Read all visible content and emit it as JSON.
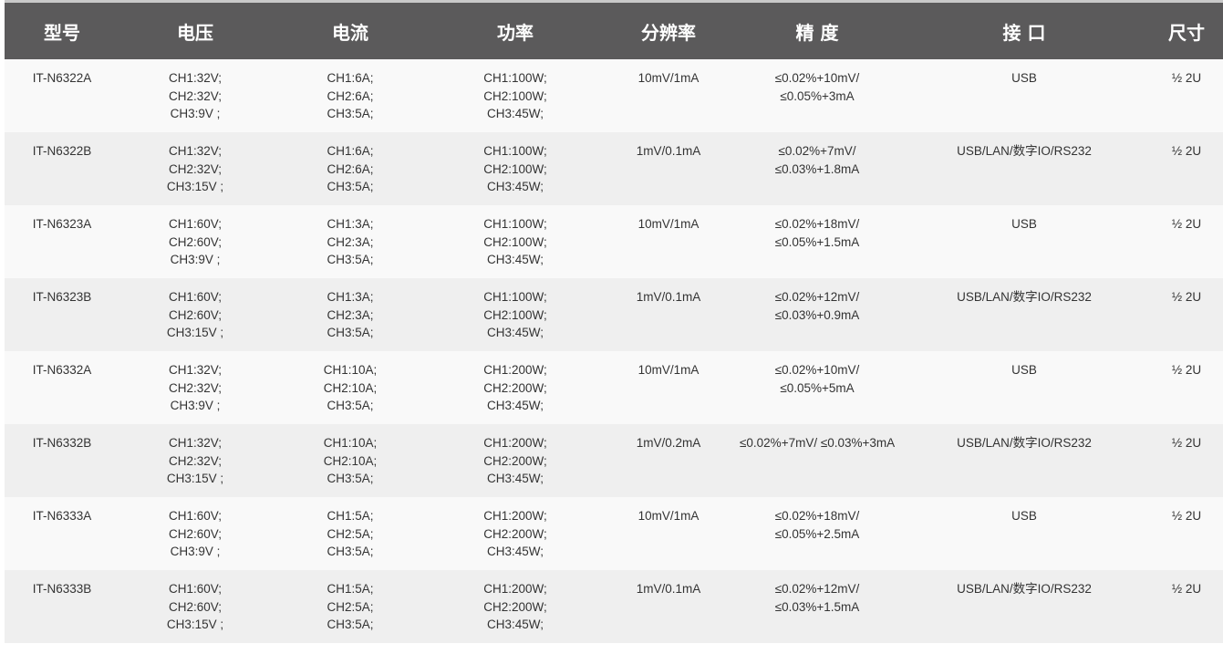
{
  "headers": [
    "型号",
    "电压",
    "电流",
    "功率",
    "分辨率",
    "精 度",
    "接 口",
    "尺寸"
  ],
  "rows": [
    {
      "model": "IT-N6322A",
      "voltage": [
        "CH1:32V;",
        "CH2:32V;",
        "CH3:9V ;"
      ],
      "current": [
        "CH1:6A;",
        "CH2:6A;",
        "CH3:5A;"
      ],
      "power": [
        "CH1:100W;",
        "CH2:100W;",
        "CH3:45W;"
      ],
      "resolution": "10mV/1mA",
      "accuracy": [
        "≤0.02%+10mV/",
        "≤0.05%+3mA"
      ],
      "interface": "USB",
      "size": "½ 2U"
    },
    {
      "model": "IT-N6322B",
      "voltage": [
        "CH1:32V;",
        "CH2:32V;",
        "CH3:15V ;"
      ],
      "current": [
        "CH1:6A;",
        "CH2:6A;",
        "CH3:5A;"
      ],
      "power": [
        "CH1:100W;",
        "CH2:100W;",
        "CH3:45W;"
      ],
      "resolution": "1mV/0.1mA",
      "accuracy": [
        "≤0.02%+7mV/",
        "≤0.03%+1.8mA"
      ],
      "interface": "USB/LAN/数字IO/RS232",
      "size": "½ 2U"
    },
    {
      "model": "IT-N6323A",
      "voltage": [
        "CH1:60V;",
        "CH2:60V;",
        "CH3:9V ;"
      ],
      "current": [
        "CH1:3A;",
        "CH2:3A;",
        "CH3:5A;"
      ],
      "power": [
        "CH1:100W;",
        "CH2:100W;",
        "CH3:45W;"
      ],
      "resolution": "10mV/1mA",
      "accuracy": [
        "≤0.02%+18mV/",
        "≤0.05%+1.5mA"
      ],
      "interface": "USB",
      "size": "½ 2U"
    },
    {
      "model": "IT-N6323B",
      "voltage": [
        "CH1:60V;",
        "CH2:60V;",
        "CH3:15V ;"
      ],
      "current": [
        "CH1:3A;",
        "CH2:3A;",
        "CH3:5A;"
      ],
      "power": [
        "CH1:100W;",
        "CH2:100W;",
        "CH3:45W;"
      ],
      "resolution": "1mV/0.1mA",
      "accuracy": [
        "≤0.02%+12mV/",
        "≤0.03%+0.9mA"
      ],
      "interface": "USB/LAN/数字IO/RS232",
      "size": "½ 2U"
    },
    {
      "model": "IT-N6332A",
      "voltage": [
        "CH1:32V;",
        "CH2:32V;",
        "CH3:9V ;"
      ],
      "current": [
        "CH1:10A;",
        "CH2:10A;",
        "CH3:5A;"
      ],
      "power": [
        "CH1:200W;",
        "CH2:200W;",
        "CH3:45W;"
      ],
      "resolution": "10mV/1mA",
      "accuracy": [
        "≤0.02%+10mV/",
        "≤0.05%+5mA"
      ],
      "interface": "USB",
      "size": "½ 2U"
    },
    {
      "model": "IT-N6332B",
      "voltage": [
        "CH1:32V;",
        "CH2:32V;",
        "CH3:15V ;"
      ],
      "current": [
        "CH1:10A;",
        "CH2:10A;",
        "CH3:5A;"
      ],
      "power": [
        "CH1:200W;",
        "CH2:200W;",
        "CH3:45W;"
      ],
      "resolution": "1mV/0.2mA",
      "accuracy": [
        "≤0.02%+7mV/ ≤0.03%+3mA"
      ],
      "interface": "USB/LAN/数字IO/RS232",
      "size": "½ 2U"
    },
    {
      "model": "IT-N6333A",
      "voltage": [
        "CH1:60V;",
        "CH2:60V;",
        "CH3:9V ;"
      ],
      "current": [
        "CH1:5A;",
        "CH2:5A;",
        "CH3:5A;"
      ],
      "power": [
        "CH1:200W;",
        "CH2:200W;",
        "CH3:45W;"
      ],
      "resolution": "10mV/1mA",
      "accuracy": [
        "≤0.02%+18mV/",
        "≤0.05%+2.5mA"
      ],
      "interface": "USB",
      "size": "½ 2U"
    },
    {
      "model": "IT-N6333B",
      "voltage": [
        "CH1:60V;",
        "CH2:60V;",
        "CH3:15V ;"
      ],
      "current": [
        "CH1:5A;",
        "CH2:5A;",
        "CH3:5A;"
      ],
      "power": [
        "CH1:200W;",
        "CH2:200W;",
        "CH3:45W;"
      ],
      "resolution": "1mV/0.1mA",
      "accuracy": [
        "≤0.02%+12mV/",
        "≤0.03%+1.5mA"
      ],
      "interface": "USB/LAN/数字IO/RS232",
      "size": "½ 2U"
    }
  ],
  "colors": {
    "header_bg": "#5b5a5b",
    "header_text": "#ffffff",
    "row_odd": "#f9f9f9",
    "row_even": "#efefef",
    "body_text": "#333333"
  }
}
